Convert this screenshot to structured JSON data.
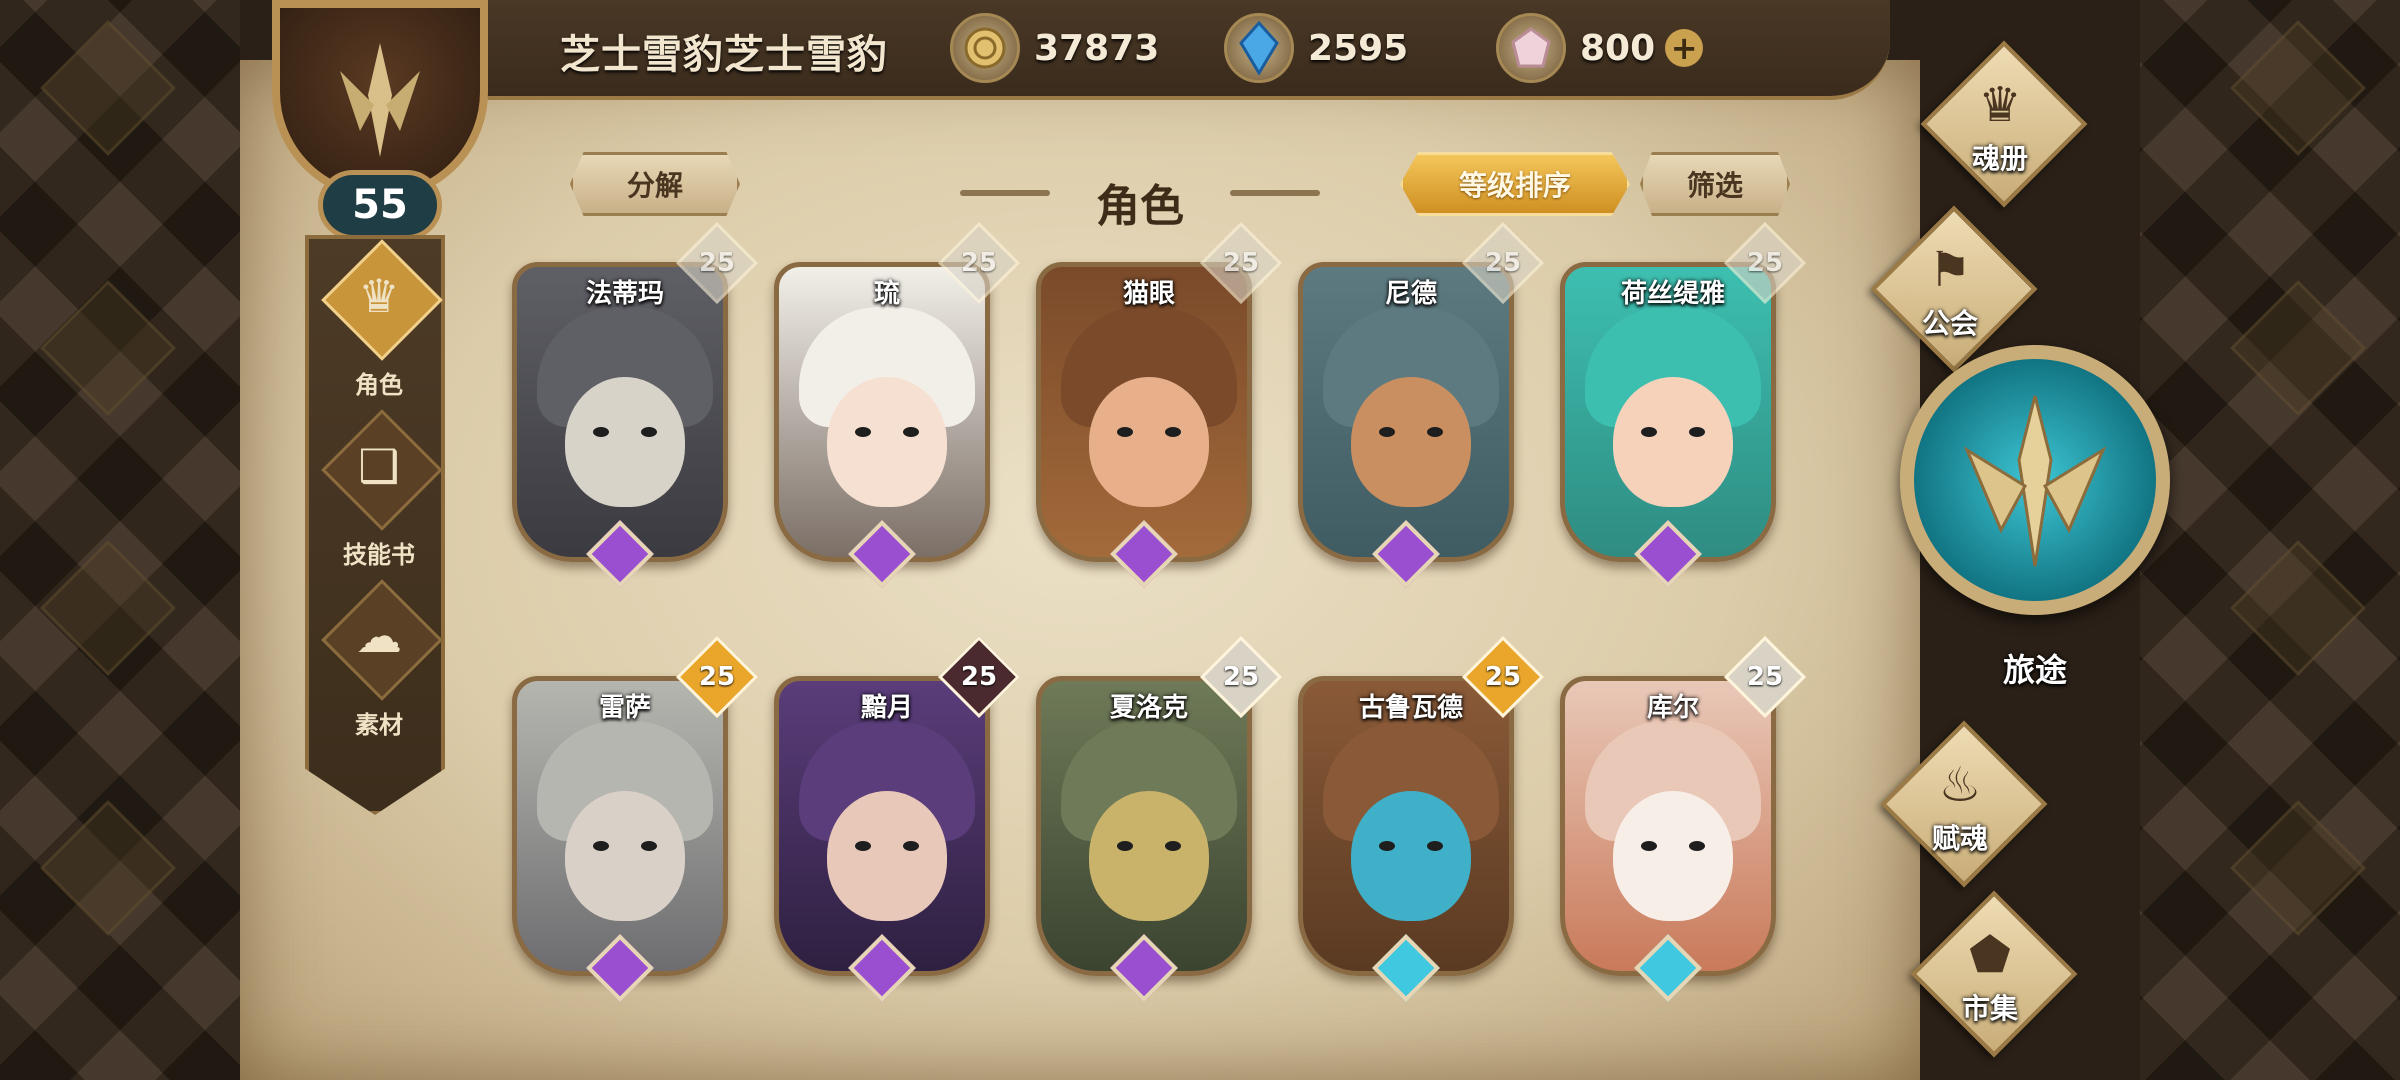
{
  "player": {
    "name": "芝士雪豹芝士雪豹",
    "level": "55"
  },
  "resources": [
    {
      "name": "gold-coin",
      "value": "37873"
    },
    {
      "name": "blue-crystal",
      "value": "2595"
    },
    {
      "name": "pink-gem",
      "value": "800",
      "plus": "+"
    }
  ],
  "left_nav": [
    {
      "label": "角色",
      "icon": "character-icon",
      "active": true
    },
    {
      "label": "技能书",
      "icon": "skillbook-icon",
      "active": false
    },
    {
      "label": "素材",
      "icon": "material-icon",
      "active": false
    }
  ],
  "header": {
    "decompose": "分解",
    "title": "角色",
    "sort": "等级排序",
    "filter": "筛选"
  },
  "cards_row1": [
    {
      "name": "法蒂玛",
      "level": "25"
    },
    {
      "name": "琉",
      "level": "25"
    },
    {
      "name": "猫眼",
      "level": "25"
    },
    {
      "name": "尼德",
      "level": "25"
    },
    {
      "name": "荷丝缇雅",
      "level": "25"
    }
  ],
  "cards_row2": [
    {
      "name": "雷萨",
      "level": "25",
      "badge": "gold",
      "rarity": "purple"
    },
    {
      "name": "黯月",
      "level": "25",
      "badge": "dark",
      "rarity": "purple"
    },
    {
      "name": "夏洛克",
      "level": "25",
      "badge": "white",
      "rarity": "purple"
    },
    {
      "name": "古鲁瓦德",
      "level": "25",
      "badge": "gold",
      "rarity": "cyan"
    },
    {
      "name": "库尔",
      "level": "25",
      "badge": "white",
      "rarity": "cyan"
    }
  ],
  "right_menu": [
    {
      "label": "魂册",
      "icon": "soul-book-icon"
    },
    {
      "label": "公会",
      "icon": "guild-icon"
    },
    {
      "label": "赋魂",
      "icon": "enchant-icon"
    },
    {
      "label": "市集",
      "icon": "market-icon"
    }
  ],
  "journey": {
    "label": "旅途",
    "icon": "journey-emblem-icon"
  },
  "colors": {
    "gold_badge": "#e9a62b",
    "dark_badge": "#4a2a2e",
    "white_badge": "#d9d3c6",
    "purple_rarity": "#9a4fd0",
    "cyan_rarity": "#3fc8e0",
    "parchment": "#dccca9",
    "frame": "#8a6a42"
  }
}
